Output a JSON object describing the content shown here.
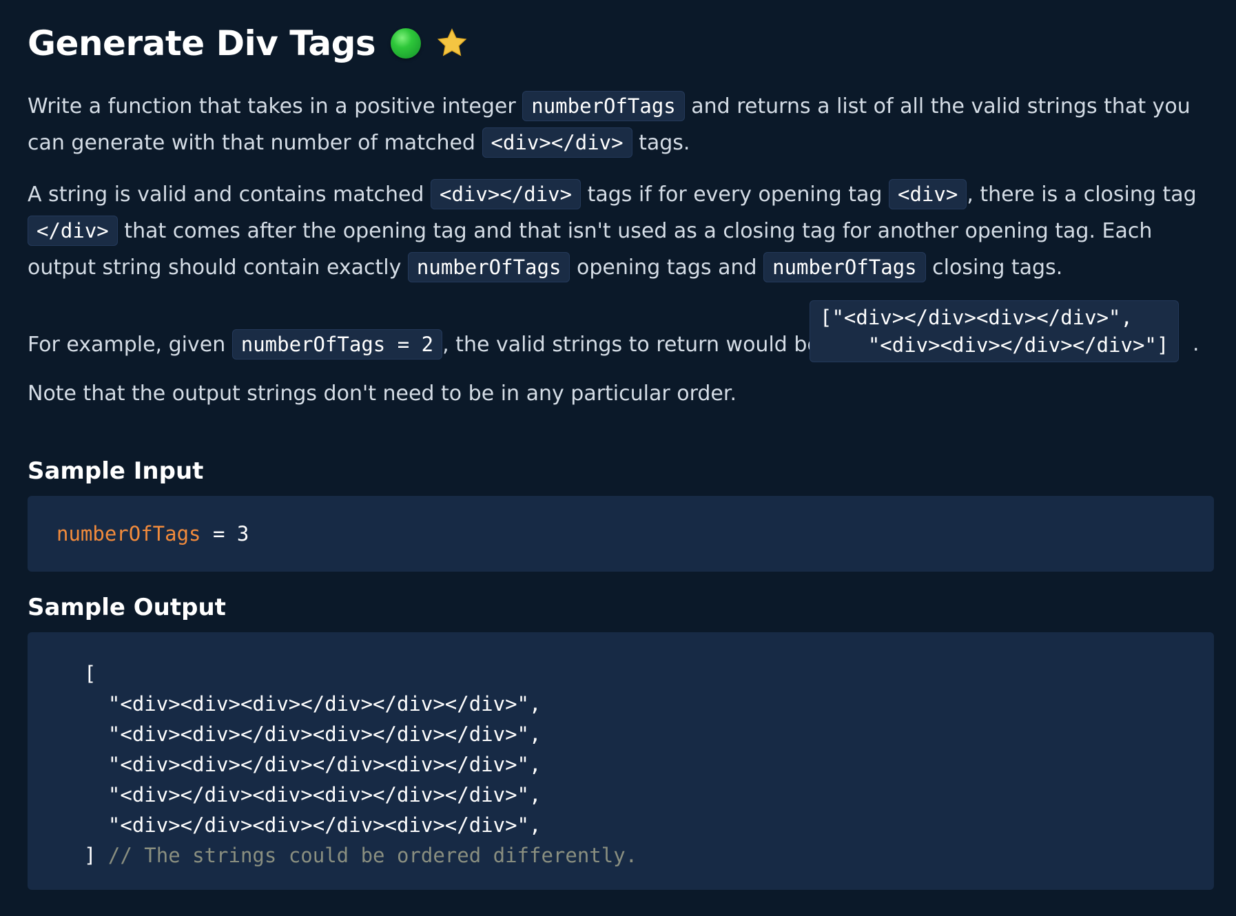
{
  "title": "Generate Div Tags",
  "icons": {
    "difficulty": "green-circle-icon",
    "favorite": "star-icon",
    "difficulty_color": "#2ec73a",
    "star_color": "#f4c542"
  },
  "description": {
    "p1": {
      "t1": "Write a function that takes in a positive integer ",
      "c1": "numberOfTags",
      "t2": " and returns a list of all the valid strings that you can generate with that number of matched ",
      "c2": "<div></div>",
      "t3": " tags."
    },
    "p2": {
      "t1": "A string is valid and contains matched ",
      "c1": "<div></div>",
      "t2": " tags if for every opening tag ",
      "c2": "<div>",
      "t3": ", there is a closing tag ",
      "c3": "</div>",
      "t4": " that comes after the opening tag and that isn't used as a closing tag for another opening tag. Each output string should contain exactly ",
      "c4": "numberOfTags",
      "t5": " opening tags and ",
      "c5": "numberOfTags",
      "t6": " closing tags."
    },
    "p3": {
      "t1": "For example, given ",
      "c1": "numberOfTags = 2",
      "t2": ", the valid strings to return would be: ",
      "block": "[\"<div></div><div></div>\",\n    \"<div><div></div></div>\"]",
      "t3": "."
    },
    "p4": "Note that the output strings don't need to be in any particular order."
  },
  "sample_input": {
    "heading": "Sample Input",
    "var_name": "numberOfTags",
    "rest": " = 3"
  },
  "sample_output": {
    "heading": "Sample Output",
    "open": "[",
    "lines": [
      "  \"<div><div><div></div></div></div>\",",
      "  \"<div><div></div><div></div></div>\",",
      "  \"<div><div></div></div><div></div>\",",
      "  \"<div></div><div><div></div></div>\",",
      "  \"<div></div><div></div><div></div>\","
    ],
    "close": "] ",
    "comment": "// The strings could be ordered differently."
  }
}
